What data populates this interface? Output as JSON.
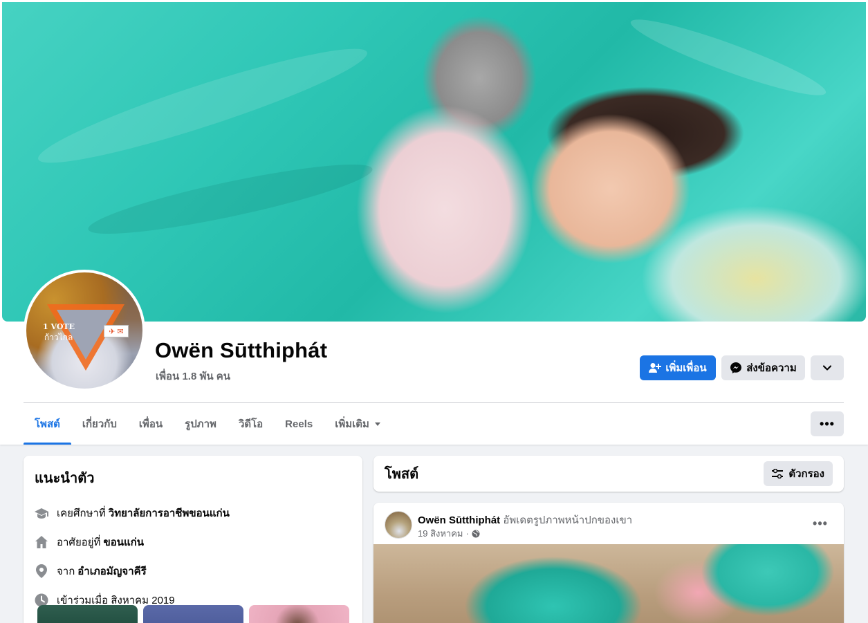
{
  "profile": {
    "name": "Owën Sūtthiphát",
    "friends": "เพื่อน 1.8 พัน คน",
    "avatar_text_line1": "1 VOTE",
    "avatar_text_line2": "ก้าวไกล"
  },
  "actions": {
    "add_friend": "เพิ่มเพื่อน",
    "message": "ส่งข้อความ"
  },
  "tabs": [
    {
      "label": "โพสต์",
      "active": true
    },
    {
      "label": "เกี่ยวกับ"
    },
    {
      "label": "เพื่อน"
    },
    {
      "label": "รูปภาพ"
    },
    {
      "label": "วิดีโอ"
    },
    {
      "label": "Reels"
    },
    {
      "label": "เพิ่มเติม"
    }
  ],
  "intro": {
    "title": "แนะนำตัว",
    "education_prefix": "เคยศึกษาที่",
    "education_value": "วิทยาลัยการอาชีพขอนแก่น",
    "lives_prefix": "อาศัยอยู่ที่",
    "lives_value": "ขอนแก่น",
    "from_prefix": "จาก",
    "from_value": "อำเภอมัญจาคีรี",
    "joined": "เข้าร่วมเมื่อ สิงหาคม 2019"
  },
  "posts": {
    "title": "โพสต์",
    "filter_label": "ตัวกรอง"
  },
  "post": {
    "author": "Owën Sūtthiphát",
    "action": "อัพเดตรูปภาพหน้าปกของเขา",
    "date": "19 สิงหาคม",
    "separator": "·"
  },
  "colors": {
    "primary": "#1b74e4",
    "secondary_btn": "#e4e6eb",
    "muted_text": "#65676b",
    "page_bg": "#f0f2f5"
  }
}
